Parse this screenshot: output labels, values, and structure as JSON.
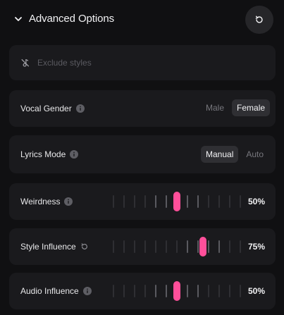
{
  "header": {
    "title": "Advanced Options",
    "chevron_icon": "chevron-down-icon",
    "reset_icon": "reset-icon"
  },
  "exclude": {
    "placeholder": "Exclude styles",
    "icon": "no-style-icon"
  },
  "vocal_gender": {
    "label": "Vocal Gender",
    "options": [
      "Male",
      "Female"
    ],
    "selected": "Female"
  },
  "lyrics_mode": {
    "label": "Lyrics Mode",
    "options": [
      "Manual",
      "Auto"
    ],
    "selected": "Manual"
  },
  "sliders": [
    {
      "label": "Weirdness",
      "value": 50,
      "display": "50%",
      "icon": "info-icon"
    },
    {
      "label": "Style Influence",
      "value": 75,
      "display": "75%",
      "icon": "reset-icon"
    },
    {
      "label": "Audio Influence",
      "value": 50,
      "display": "50%",
      "icon": "info-icon"
    }
  ],
  "colors": {
    "accent": "#ff4f9a",
    "background": "#101012",
    "card": "#1a1a1d"
  }
}
